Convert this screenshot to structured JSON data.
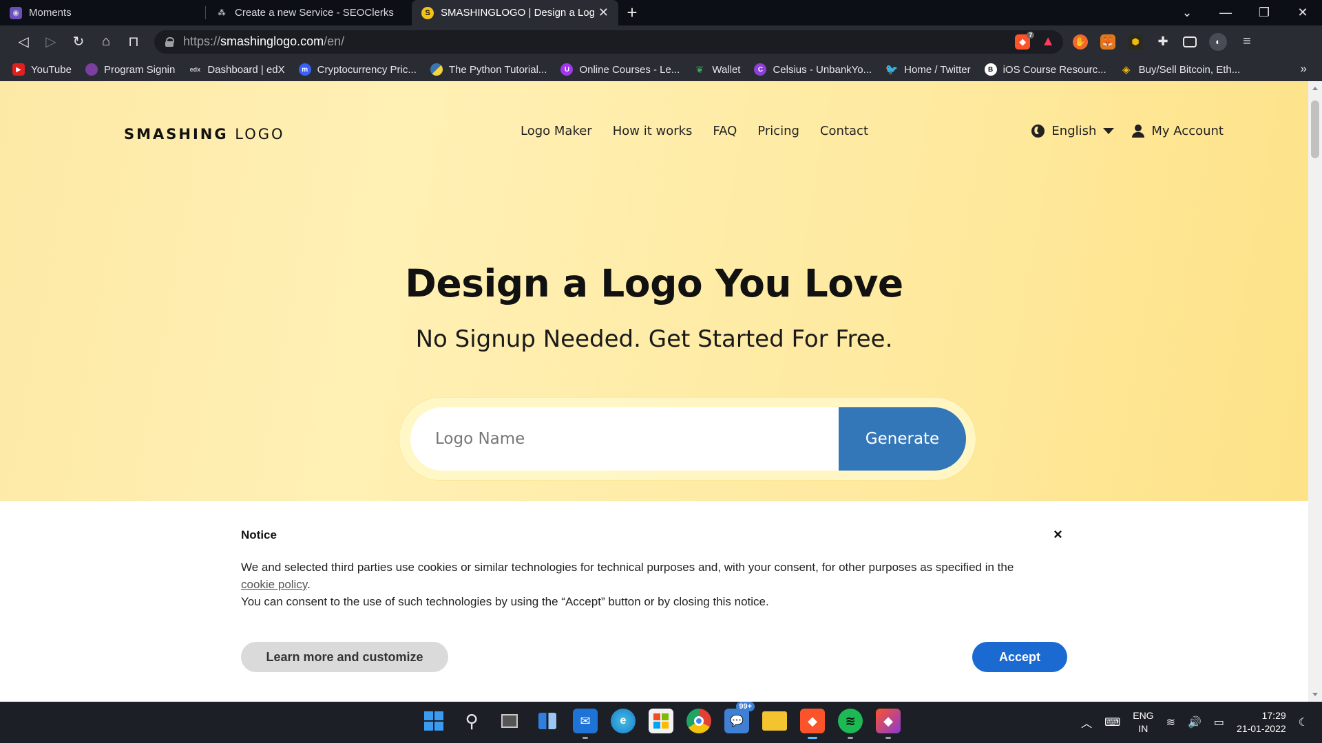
{
  "browser": {
    "tabs": [
      {
        "title": "Moments",
        "icon": "moments-icon",
        "color": "#6b4fbb",
        "active": false
      },
      {
        "title": "Create a new Service - SEOClerks",
        "icon": "seoclerks-icon",
        "color": "#8a8c94",
        "active": false
      },
      {
        "title": "SMASHINGLOGO | Design a Logo",
        "icon": "smashinglogo-icon",
        "color": "#f3c316",
        "active": true
      }
    ],
    "url": {
      "protocol": "https://",
      "host": "smashinglogo.com",
      "path": "/en/"
    },
    "brave_badge": "7",
    "bookmarks": [
      {
        "label": "YouTube",
        "icon": "youtube-icon",
        "color": "#e0201c"
      },
      {
        "label": "Program Signin",
        "icon": "program-icon",
        "color": "#7b3fa0"
      },
      {
        "label": "Dashboard | edX",
        "icon": "edx-icon",
        "color": "#2a2c34"
      },
      {
        "label": "Cryptocurrency Pric...",
        "icon": "coinmarketcap-icon",
        "color": "#3861fb"
      },
      {
        "label": "The Python Tutorial...",
        "icon": "python-icon",
        "color": "#3a75b0"
      },
      {
        "label": "Online Courses - Le...",
        "icon": "udemy-icon",
        "color": "#a435f0"
      },
      {
        "label": "Wallet",
        "icon": "wallet-leaf-icon",
        "color": "#3aa757"
      },
      {
        "label": "Celsius - UnbankYo...",
        "icon": "celsius-icon",
        "color": "#8e3fd6"
      },
      {
        "label": "Home / Twitter",
        "icon": "twitter-icon",
        "color": "#1d9bf0"
      },
      {
        "label": "iOS Course Resourc...",
        "icon": "ios-course-icon",
        "color": "#ffffff"
      },
      {
        "label": "Buy/Sell Bitcoin, Eth...",
        "icon": "binance-icon",
        "color": "#f0b90b"
      }
    ]
  },
  "site": {
    "logo_bold": "SMASHING",
    "logo_light": "LOGO",
    "nav": [
      "Logo Maker",
      "How it works",
      "FAQ",
      "Pricing",
      "Contact"
    ],
    "language": "English",
    "account": "My Account",
    "headline": "Design a Logo You Love",
    "subheadline": "No Signup Needed. Get Started For Free.",
    "input_placeholder": "Logo Name",
    "generate_label": "Generate",
    "accent_color": "#3377b8"
  },
  "notice": {
    "title": "Notice",
    "close": "×",
    "line1_before": "We and selected third parties use cookies or similar technologies for technical purposes and, with your consent, for other purposes as specified in the",
    "link": "cookie policy",
    "line1_after": ".",
    "line2": "You can consent to the use of such technologies by using the “Accept” button or by closing this notice.",
    "learn_more": "Learn more and customize",
    "accept": "Accept"
  },
  "taskbar": {
    "apps": [
      {
        "name": "start",
        "icon": "windows-start-icon",
        "color": "#3a9bf0"
      },
      {
        "name": "search",
        "icon": "search-icon",
        "color": "#e6e6e6"
      },
      {
        "name": "task-view",
        "icon": "task-view-icon",
        "color": "#c8c8c8"
      },
      {
        "name": "widgets",
        "icon": "widgets-icon",
        "color": "#2f7fe0"
      },
      {
        "name": "mail",
        "icon": "mail-icon",
        "color": "#1e73d6"
      },
      {
        "name": "edge",
        "icon": "edge-icon",
        "color": "#1aa08a"
      },
      {
        "name": "store",
        "icon": "store-icon",
        "color": "#f2f2f2"
      },
      {
        "name": "chrome",
        "icon": "chrome-icon",
        "color": "#e34133"
      },
      {
        "name": "messages",
        "icon": "chat-icon",
        "color": "#3f7fd4",
        "badge": "99+"
      },
      {
        "name": "files",
        "icon": "folder-icon",
        "color": "#f4c430"
      },
      {
        "name": "brave",
        "icon": "brave-icon",
        "color": "#fb542b"
      },
      {
        "name": "spotify",
        "icon": "spotify-icon",
        "color": "#1db954"
      },
      {
        "name": "brave-beta",
        "icon": "brave-beta-icon",
        "color": "#fb542b"
      }
    ],
    "lang_top": "ENG",
    "lang_bottom": "IN",
    "time": "17:29",
    "date": "21-01-2022"
  }
}
